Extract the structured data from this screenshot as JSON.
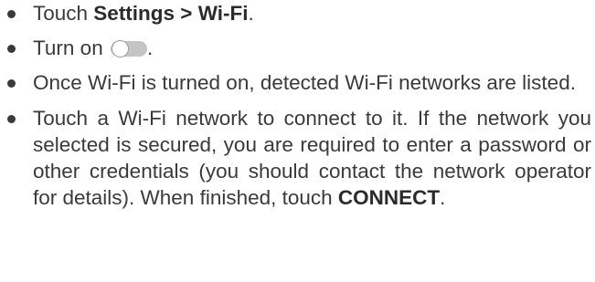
{
  "steps": [
    {
      "prefix": "Touch ",
      "bold": "Settings > Wi-Fi",
      "suffix": "."
    },
    {
      "prefix": "Turn on ",
      "toggle_icon": "switch-off-icon",
      "suffix": "."
    },
    {
      "text": "Once Wi-Fi is turned on, detected Wi-Fi networks are listed."
    },
    {
      "text": "Touch a Wi-Fi network to connect to it. If the network you selected is secured, you are required to enter a password or other credentials (you should contact the network operator for details). When finished, touch ",
      "bold": "CONNECT",
      "suffix": "."
    }
  ]
}
